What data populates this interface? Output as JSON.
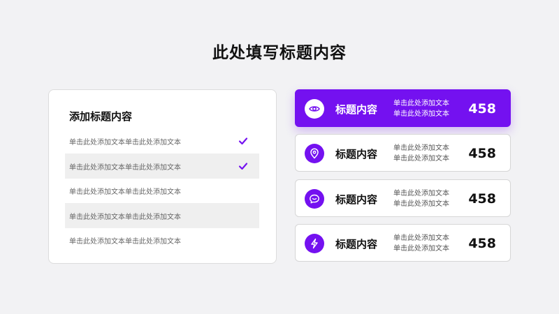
{
  "title": "此处填写标题内容",
  "left_card": {
    "heading": "添加标题内容",
    "items": [
      {
        "text": "单击此处添加文本单击此处添加文本",
        "checked": true
      },
      {
        "text": "单击此处添加文本单击此处添加文本",
        "checked": true
      },
      {
        "text": "单击此处添加文本单击此处添加文本",
        "checked": false
      },
      {
        "text": "单击此处添加文本单击此处添加文本",
        "checked": false
      },
      {
        "text": "单击此处添加文本单击此处添加文本",
        "checked": false
      }
    ],
    "check_color": "#7411f0"
  },
  "stats": [
    {
      "icon": "eye-icon",
      "label": "标题内容",
      "desc_line1": "单击此处添加文本",
      "desc_line2": "单击此处添加文本",
      "value": "458",
      "active": true
    },
    {
      "icon": "location-pin-icon",
      "label": "标题内容",
      "desc_line1": "单击此处添加文本",
      "desc_line2": "单击此处添加文本",
      "value": "458",
      "active": false
    },
    {
      "icon": "chat-bubble-icon",
      "label": "标题内容",
      "desc_line1": "单击此处添加文本",
      "desc_line2": "单击此处添加文本",
      "value": "458",
      "active": false
    },
    {
      "icon": "lightning-icon",
      "label": "标题内容",
      "desc_line1": "单击此处添加文本",
      "desc_line2": "单击此处添加文本",
      "value": "458",
      "active": false
    }
  ],
  "colors": {
    "accent": "#7411f0",
    "background": "#f2f2f4"
  }
}
